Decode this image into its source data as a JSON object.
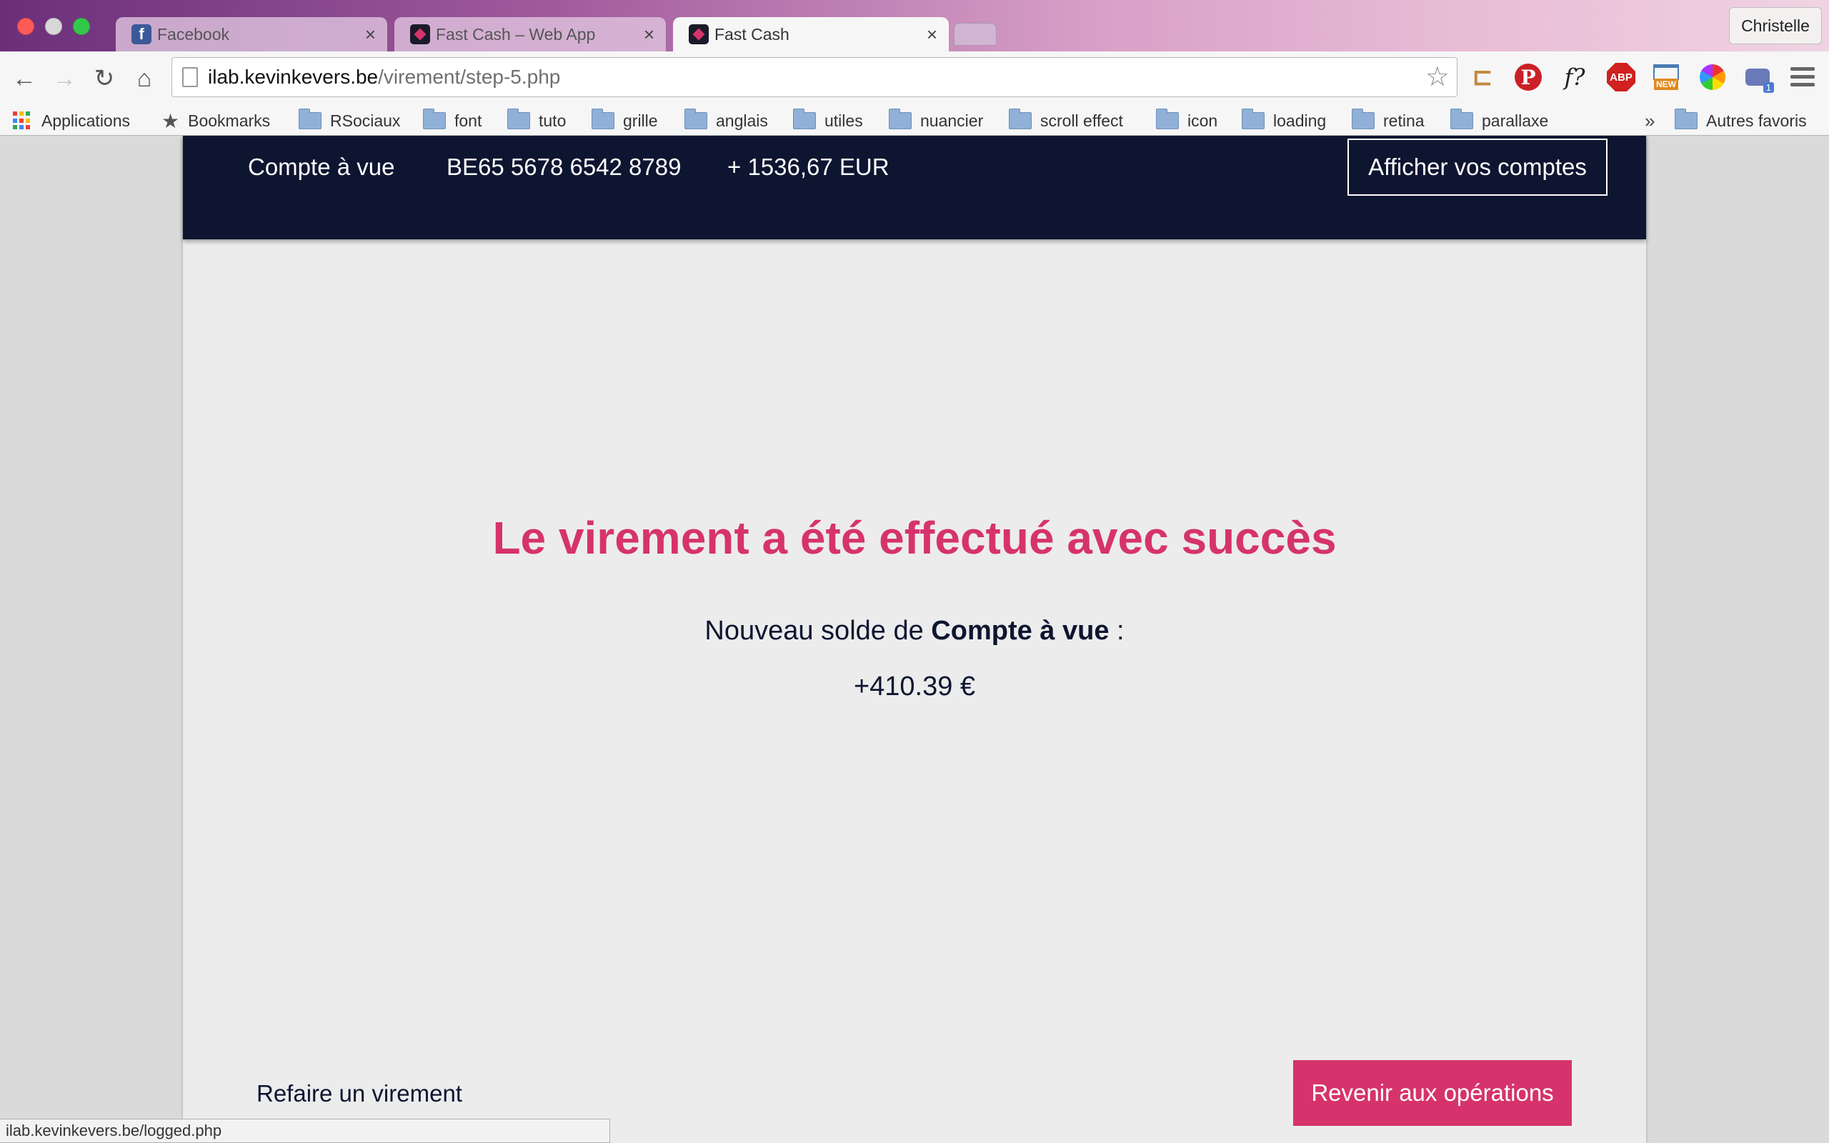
{
  "browser": {
    "tabs": [
      {
        "label": "Facebook",
        "favicon": "facebook-icon"
      },
      {
        "label": "Fast Cash – Web App",
        "favicon": "fastcash-icon"
      },
      {
        "label": "Fast Cash",
        "favicon": "fastcash-icon"
      }
    ],
    "active_tab_index": 2,
    "profile_name": "Christelle",
    "url_host": "ilab.kevinkevers.be",
    "url_path": "/virement/step-5.php",
    "bookmarks": [
      {
        "label": "Applications",
        "icon": "apps-grid-icon"
      },
      {
        "label": "Bookmarks",
        "icon": "star-icon"
      },
      {
        "label": "RSociaux",
        "icon": "folder-icon"
      },
      {
        "label": "font",
        "icon": "folder-icon"
      },
      {
        "label": "tuto",
        "icon": "folder-icon"
      },
      {
        "label": "grille",
        "icon": "folder-icon"
      },
      {
        "label": "anglais",
        "icon": "folder-icon"
      },
      {
        "label": "utiles",
        "icon": "folder-icon"
      },
      {
        "label": "nuancier",
        "icon": "folder-icon"
      },
      {
        "label": "scroll effect",
        "icon": "folder-icon"
      },
      {
        "label": "icon",
        "icon": "folder-icon"
      },
      {
        "label": "loading",
        "icon": "folder-icon"
      },
      {
        "label": "retina",
        "icon": "folder-icon"
      },
      {
        "label": "parallaxe",
        "icon": "folder-icon"
      }
    ],
    "bookmarks_overflow": "»",
    "other_bookmarks": "Autres favoris",
    "extensions": {
      "font_label": "f?",
      "abp_label": "ABP",
      "new_badge": "NEW",
      "chat_count": "1"
    },
    "status_url": "ilab.kevinkevers.be/logged.php"
  },
  "app": {
    "header": {
      "account_name": "Compte à vue",
      "iban": "BE65 5678 6542 8789",
      "balance": "+ 1536,67 EUR",
      "accounts_button": "Afficher vos comptes"
    },
    "confirmation": {
      "title": "Le virement a été effectué avec succès",
      "balance_prefix": "Nouveau solde de",
      "balance_account": "Compte à vue",
      "balance_suffix": " :",
      "new_balance": "+410.39 €"
    },
    "actions": {
      "redo_transfer": "Refaire un virement",
      "back_to_operations": "Revenir aux opérations"
    }
  },
  "colors": {
    "header_navy": "#0d1530",
    "accent_pink": "#d6336c",
    "page_bg": "#ececec"
  }
}
